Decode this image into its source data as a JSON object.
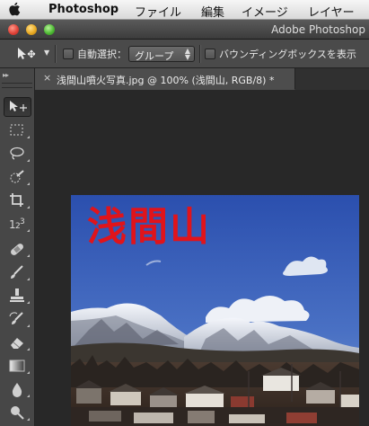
{
  "menubar": {
    "app_name": "Photoshop",
    "items": [
      "ファイル",
      "編集",
      "イメージ",
      "レイヤー"
    ]
  },
  "window": {
    "title": "Adobe Photoshop"
  },
  "options_bar": {
    "auto_select_label": "自動選択：",
    "auto_select_value": "グループ",
    "bounding_box_label": "バウンディングボックスを表示"
  },
  "document": {
    "tab_title": "浅間山噴火写真.jpg @ 100% (浅間山, RGB/8) *",
    "tab_close": "×"
  },
  "photo": {
    "overlay_text": "浅間山"
  },
  "colors": {
    "menubar": "#e6e6e6",
    "panel": "#474747",
    "canvas_bg": "#282828",
    "sky": "#3f63b8",
    "overlay_text": "#e0141b"
  }
}
